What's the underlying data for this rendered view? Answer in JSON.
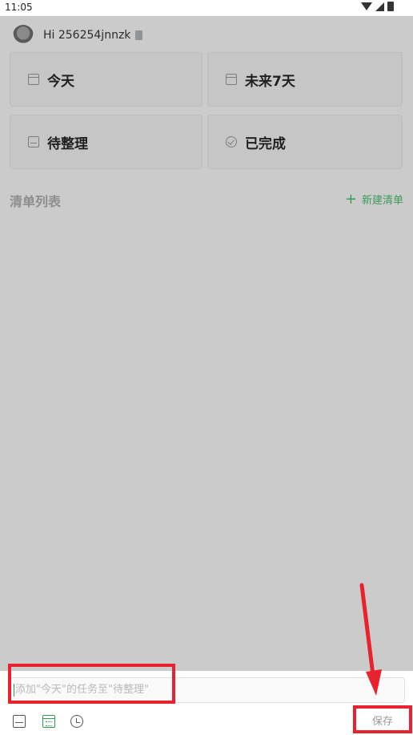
{
  "status_bar": {
    "time": "11:05"
  },
  "header": {
    "greeting": "Hi 256254jnnzk"
  },
  "quick_filters": [
    {
      "label": "今天",
      "icon": "calendar-today-icon"
    },
    {
      "label": "未来7天",
      "icon": "calendar-7-icon"
    },
    {
      "label": "待整理",
      "icon": "inbox-icon"
    },
    {
      "label": "已完成",
      "icon": "check-circle-icon"
    }
  ],
  "lists_section": {
    "title": "清单列表",
    "new_list_label": "新建清单",
    "new_list_icon": "plus-icon"
  },
  "composer": {
    "placeholder": "添加\"今天\"的任务至\"待整理\"",
    "save_label": "保存",
    "tools": [
      "inbox-icon",
      "calendar-icon",
      "alarm-icon"
    ]
  },
  "colors": {
    "accent": "#3c9b5b",
    "annotation": "#e8232f",
    "overlay": "#cbcbcb"
  }
}
